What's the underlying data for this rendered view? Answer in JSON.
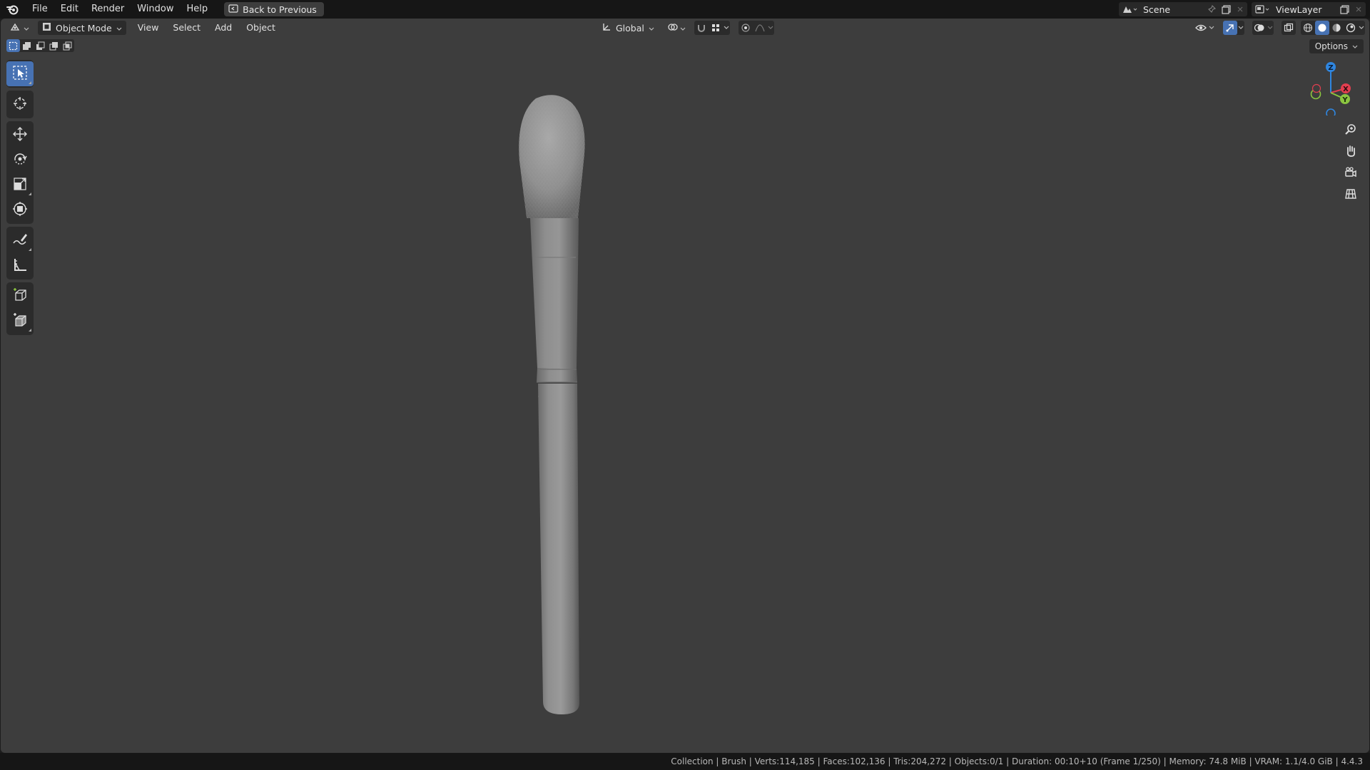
{
  "topbar": {
    "menus": [
      "File",
      "Edit",
      "Render",
      "Window",
      "Help"
    ],
    "back_label": "Back to Previous",
    "scene_name": "Scene",
    "view_layer_name": "ViewLayer"
  },
  "viewport_header": {
    "mode_label": "Object Mode",
    "menus": [
      "View",
      "Select",
      "Add",
      "Object"
    ],
    "transform_orientation": "Global",
    "options_label": "Options"
  },
  "toolbar": {
    "tools": [
      {
        "name": "select-box",
        "icon": "select-box-icon",
        "active": true
      },
      {
        "name": "cursor",
        "icon": "cursor-icon",
        "active": false
      },
      {
        "name": "move",
        "icon": "move-icon",
        "active": false
      },
      {
        "name": "rotate",
        "icon": "rotate-icon",
        "active": false
      },
      {
        "name": "scale",
        "icon": "scale-icon",
        "active": false
      },
      {
        "name": "transform",
        "icon": "transform-icon",
        "active": false
      },
      {
        "name": "annotate",
        "icon": "annotate-icon",
        "active": false
      },
      {
        "name": "measure",
        "icon": "measure-icon",
        "active": false
      },
      {
        "name": "add-cube",
        "icon": "add-cube-icon",
        "active": false
      },
      {
        "name": "add-object",
        "icon": "add-object-icon",
        "active": false
      }
    ]
  },
  "gizmo": {
    "axes": {
      "x": "X",
      "y": "Y",
      "z": "Z"
    },
    "colors": {
      "x": "#e33e4f",
      "y": "#8bc540",
      "z": "#2f86e0"
    }
  },
  "colors": {
    "accent": "#4772b3",
    "viewport_bg": "#3d3d3d",
    "bar_bg": "#161616"
  },
  "statusbar": {
    "text": "Collection | Brush | Verts:114,185 | Faces:102,136 | Tris:204,272 | Objects:0/1 | Duration: 00:10+10 (Frame 1/250) | Memory: 74.8 MiB | VRAM: 1.1/4.0 GiB | 4.4.3"
  }
}
